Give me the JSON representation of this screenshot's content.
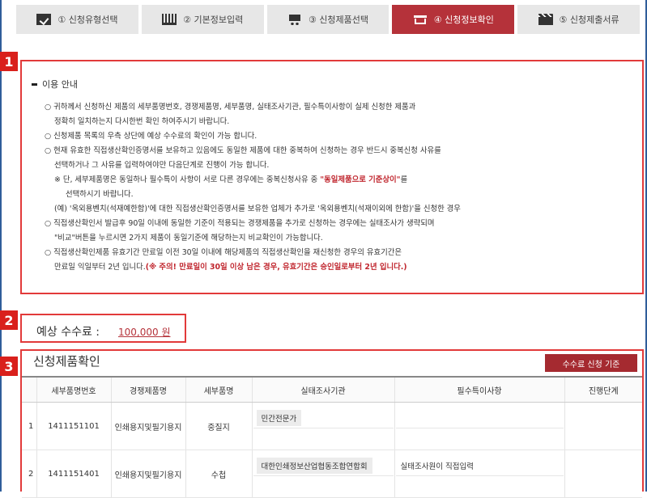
{
  "steps": [
    {
      "label": "① 신청유형선택",
      "icon": "check-icon"
    },
    {
      "label": "② 기본정보입력",
      "icon": "bars-icon"
    },
    {
      "label": "③ 신청제품선택",
      "icon": "cart-icon"
    },
    {
      "label": "④ 신청정보확인",
      "icon": "box-icon"
    },
    {
      "label": "⑤ 신청제출서류",
      "icon": "clapper-icon"
    }
  ],
  "active_step_color": "#b5323a",
  "badges": {
    "b1": "1",
    "b2": "2",
    "b3": "3"
  },
  "notice": {
    "title": "이용 안내",
    "l1": "○ 귀하께서 신청하신 제품의 세부품명번호, 경쟁제품명, 세부품명, 실태조사기관, 필수특이사항이 실제 신청한 제품과",
    "l2": "정확히 일치하는지 다시한번 확인 하여주시기 바랍니다.",
    "l3": "○ 신청제품 목록의 우측 상단에 예상 수수료의 확인이 가능 합니다.",
    "l4": "○ 현재 유효한 직접생산확인증명서를 보유하고 있음에도 동일한 제품에 대한 중복하여 신청하는 경우 반드시 중복신청 사유를",
    "l5": "선택하거나 그 사유를 입력하여야만 다음단계로 진행이 가능 합니다.",
    "l6a": "※ 단, 세부제품명은 동일하나 필수특이 사항이 서로 다른 경우에는 중복신청사유 중 ",
    "l6b": "\"동일제품으로 기준상이\"",
    "l6c": "를",
    "l7": "선택하시기 바랍니다.",
    "l8": "(예) '옥외용벤치(석재예한함)'에 대한 직접생산확인증명서를 보유한 업체가 추가로 '옥외용벤치(석재이외에 한함)'을 신청한 경우",
    "l9": "○ 직접생산확인서 발급후 90일 이내에 동일한 기준이 적용되는 경쟁제품을 추가로 신청하는 경우에는 실태조사가 생략되며",
    "l10": "\"비교\"버튼을 누르시면 2가지 제품이 동일기준에 해당하는지 비교확인이 가능합니다.",
    "l11": "○ 직접생산확인제품 유효기간 만료일 이전 30일 이내에 해당제품의 직접생산확인을 재신청한 경우의 유효기간은",
    "l12a": "만료일 익일부터 2년 입니다.",
    "l12b": "(※ 주의! 만료일이 30일 이상 남은 경우, 유효기간은 승인일로부터 2년 입니다.)"
  },
  "fee": {
    "label": "예상 수수료 :",
    "value": "100,000 원"
  },
  "products": {
    "title": "신청제품확인",
    "fee_standard_button": "수수료 신청 기준",
    "headers": [
      "",
      "세부품명번호",
      "경쟁제품명",
      "세부품명",
      "실태조사기관",
      "필수특이사항",
      "진행단계"
    ],
    "rows": [
      {
        "no": "1",
        "code": "1411151101",
        "comp": "인쇄용지및필기용지",
        "detail": "중질지",
        "agency": "민간전문가",
        "special": "",
        "stage": ""
      },
      {
        "no": "2",
        "code": "1411151401",
        "comp": "인쇄용지및필기용지",
        "detail": "수첩",
        "agency": "대한인쇄정보산업협동조합연합회",
        "special": "실태조사원이 직접입력",
        "stage": ""
      }
    ]
  }
}
